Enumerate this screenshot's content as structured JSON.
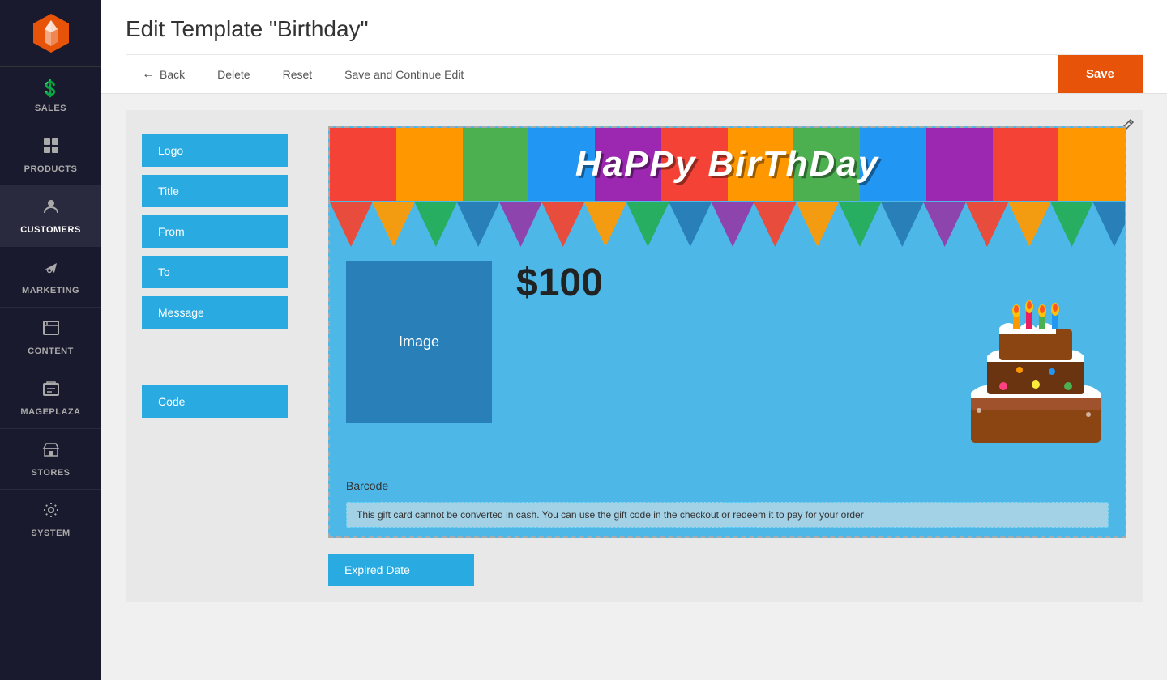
{
  "page": {
    "title": "Edit Template \"Birthday\""
  },
  "toolbar": {
    "back_label": "Back",
    "delete_label": "Delete",
    "reset_label": "Reset",
    "save_continue_label": "Save and Continue Edit",
    "save_label": "Save"
  },
  "sidebar": {
    "items": [
      {
        "id": "sales",
        "label": "SALES",
        "icon": "💲"
      },
      {
        "id": "products",
        "label": "PRODUCTS",
        "icon": "📦"
      },
      {
        "id": "customers",
        "label": "CUSTOMERS",
        "icon": "👤"
      },
      {
        "id": "marketing",
        "label": "MARKETING",
        "icon": "📣"
      },
      {
        "id": "content",
        "label": "CONTENT",
        "icon": "🖥"
      },
      {
        "id": "mageplaza",
        "label": "MAGEPLAZA",
        "icon": "🏪"
      },
      {
        "id": "stores",
        "label": "STORES",
        "icon": "🏬"
      },
      {
        "id": "system",
        "label": "SYSTEM",
        "icon": "⚙"
      }
    ]
  },
  "fields": {
    "logo_label": "Logo",
    "title_label": "Title",
    "from_label": "From",
    "to_label": "To",
    "message_label": "Message",
    "code_label": "Code",
    "expired_date_label": "Expired Date"
  },
  "preview": {
    "banner_text": "HaPPy BirThDay",
    "image_label": "Image",
    "price": "$100",
    "barcode_label": "Barcode",
    "disclaimer": "This gift card cannot be converted in cash. You can use the gift code in the checkout or redeem it to pay for your order"
  },
  "colors": {
    "pennants": [
      "#e74c3c",
      "#f39c12",
      "#2ecc71",
      "#3498db",
      "#9b59b6",
      "#e74c3c",
      "#f39c12",
      "#2ecc71",
      "#3498db",
      "#9b59b6",
      "#e74c3c",
      "#f39c12",
      "#2ecc71",
      "#3498db",
      "#9b59b6",
      "#e74c3c",
      "#f39c12",
      "#2ecc71",
      "#3498db",
      "#9b59b6",
      "#e74c3c",
      "#f39c12",
      "#2ecc71"
    ]
  }
}
